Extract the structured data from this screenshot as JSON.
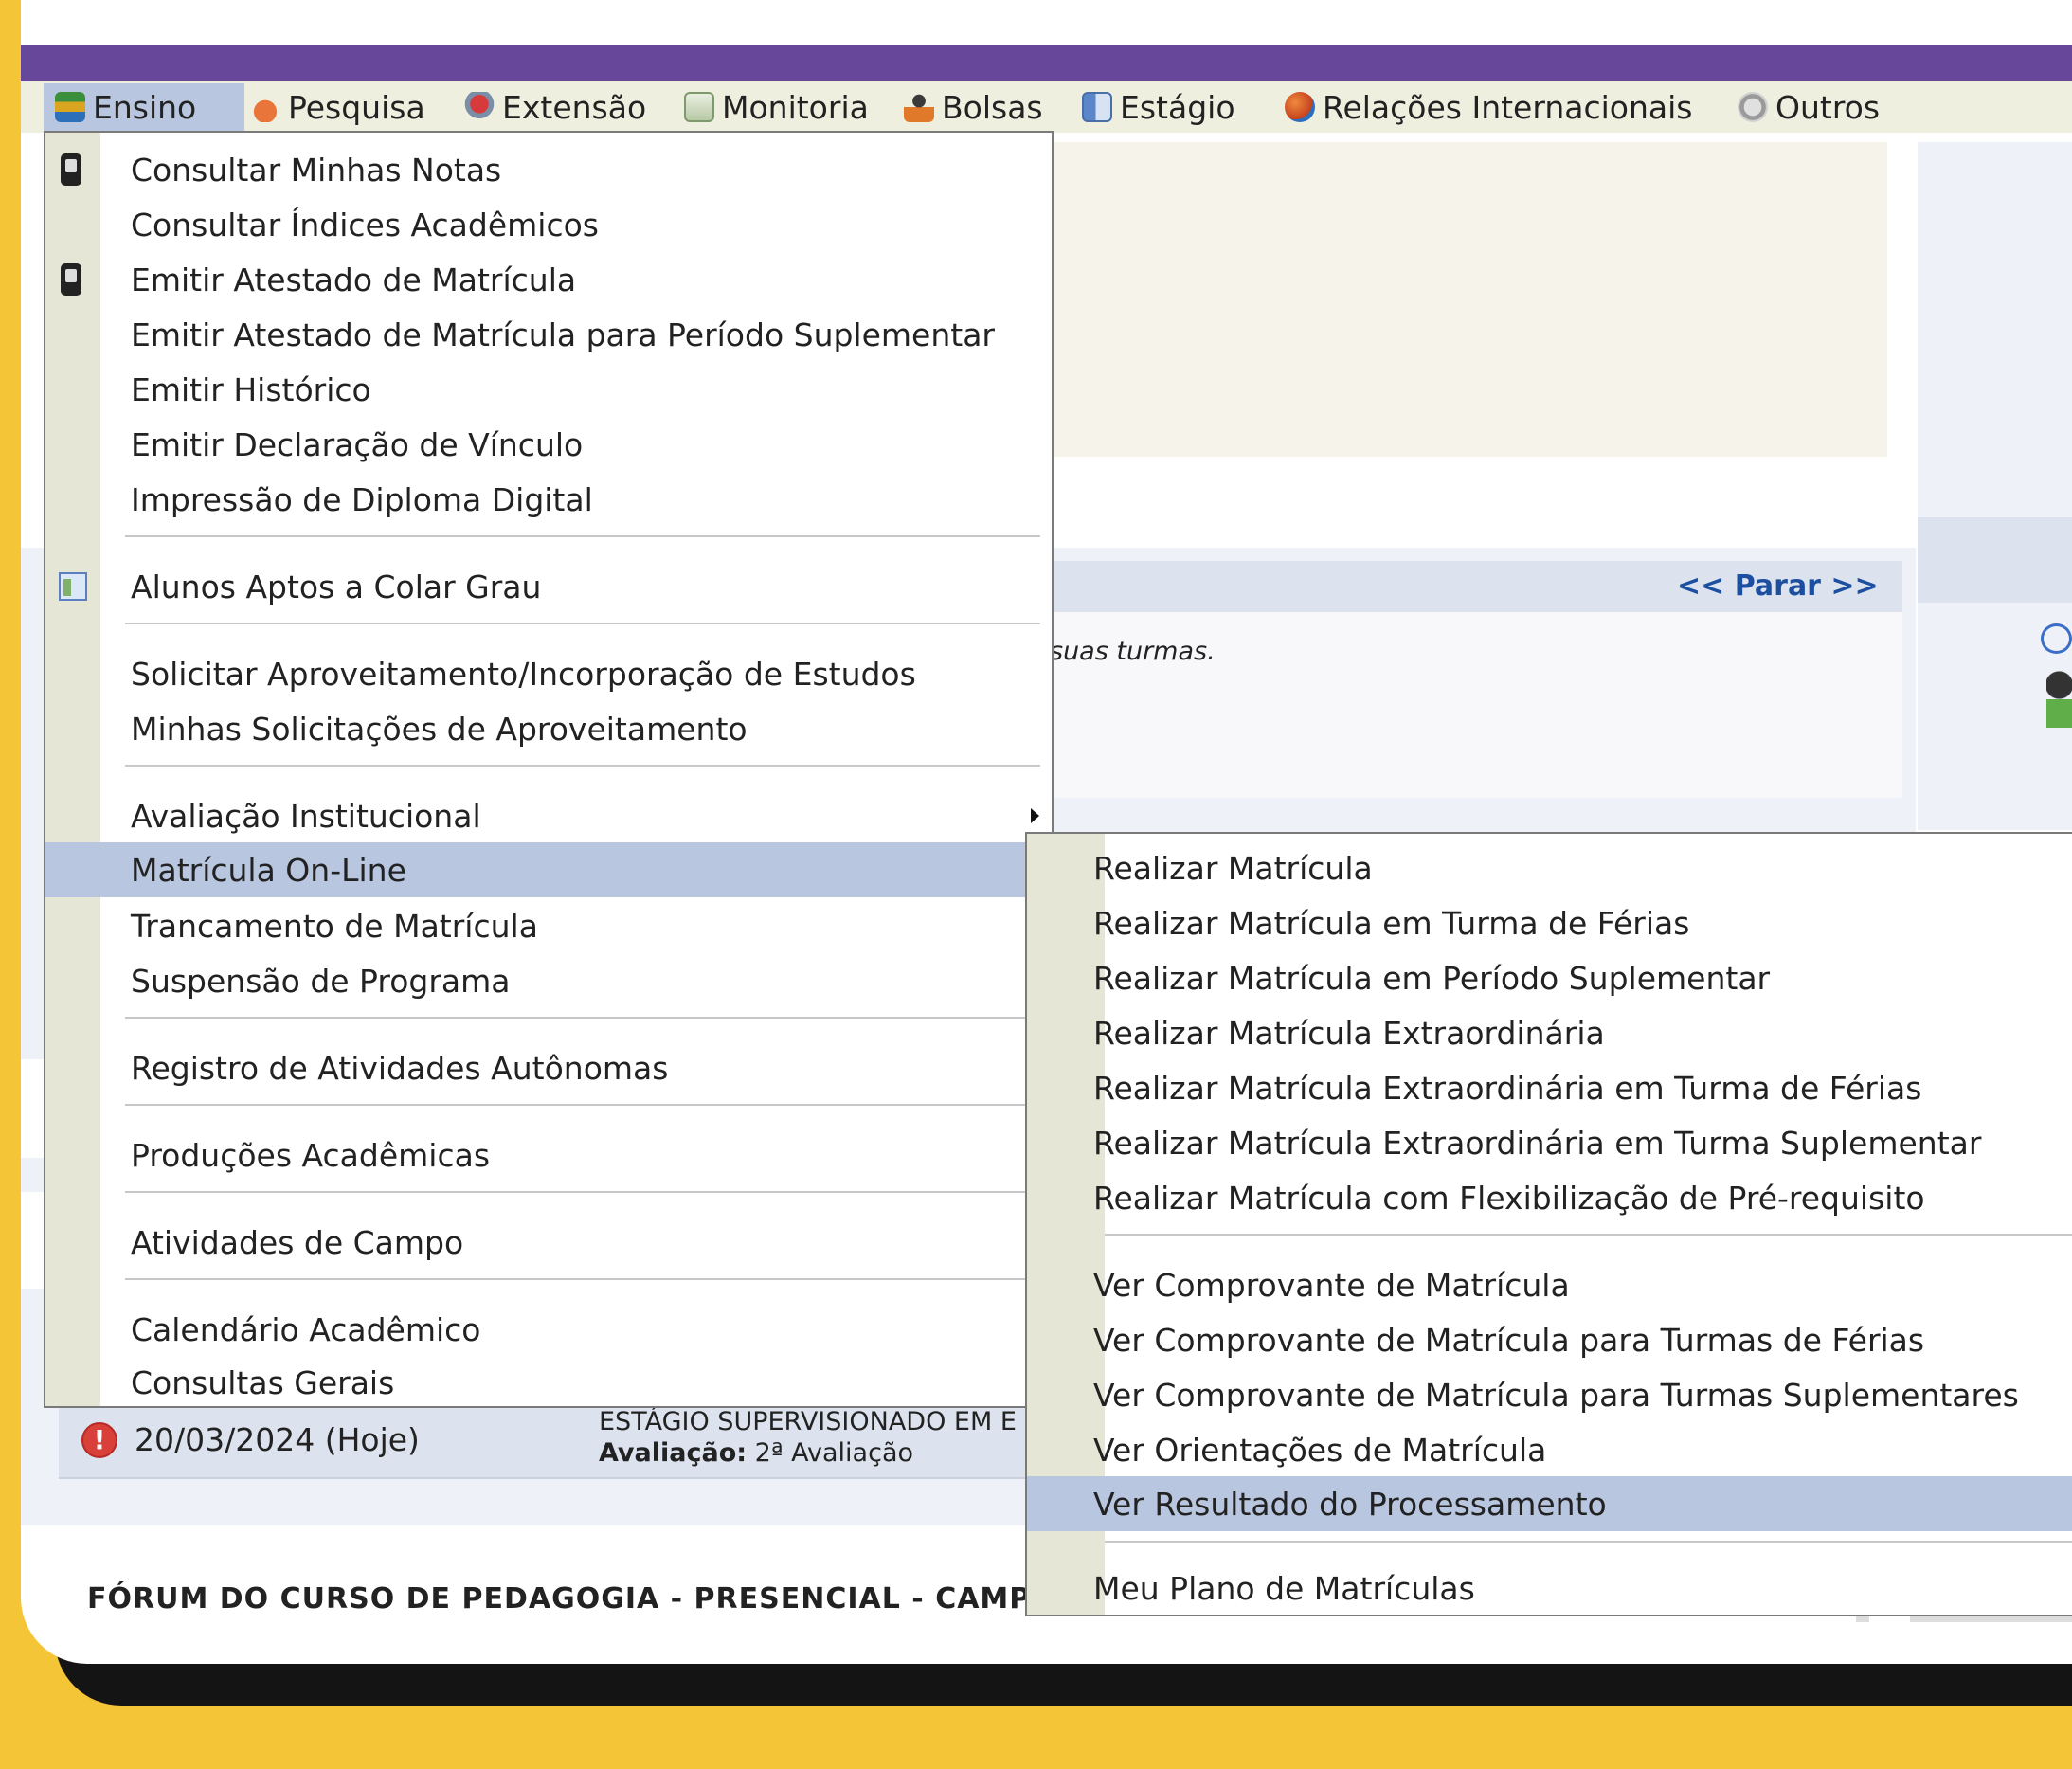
{
  "nav": {
    "items": [
      {
        "label": "Ensino",
        "icon": "books-icon"
      },
      {
        "label": "Pesquisa",
        "icon": "flask-icon"
      },
      {
        "label": "Extensão",
        "icon": "heart-hands-icon"
      },
      {
        "label": "Monitoria",
        "icon": "presentation-icon"
      },
      {
        "label": "Bolsas",
        "icon": "person-icon"
      },
      {
        "label": "Estágio",
        "icon": "id-card-icon"
      },
      {
        "label": "Relações Internacionais",
        "icon": "globe-icon"
      },
      {
        "label": "Outros",
        "icon": "robot-icon"
      }
    ]
  },
  "ensino_menu": {
    "items": [
      "Consultar Minhas Notas",
      "Consultar Índices Acadêmicos",
      "Emitir Atestado de Matrícula",
      "Emitir Atestado de Matrícula para Período Suplementar",
      "Emitir Histórico",
      "Emitir Declaração de Vínculo",
      "Impressão de Diploma Digital",
      "Alunos Aptos a Colar Grau",
      "Solicitar Aproveitamento/Incorporação de Estudos",
      "Minhas Solicitações de Aproveitamento",
      "Avaliação Institucional",
      "Matrícula On-Line",
      "Trancamento de Matrícula",
      "Suspensão de Programa",
      "Registro de Atividades Autônomas",
      "Produções Acadêmicas",
      "Atividades de Campo",
      "Calendário Acadêmico",
      "Consultas Gerais"
    ]
  },
  "matricula_submenu": {
    "items": [
      "Realizar Matrícula",
      "Realizar Matrícula em Turma de Férias",
      "Realizar Matrícula em Período Suplementar",
      "Realizar Matrícula Extraordinária",
      "Realizar Matrícula Extraordinária em Turma de Férias",
      "Realizar Matrícula Extraordinária em Turma Suplementar",
      "Realizar Matrícula com Flexibilização de Pré-requisito",
      "Ver Comprovante de Matrícula",
      "Ver Comprovante de Matrícula para Turmas de Férias",
      "Ver Comprovante de Matrícula para Turmas Suplementares",
      "Ver Orientações de Matrícula",
      "Ver Resultado do Processamento",
      "Meu Plano de Matrículas"
    ]
  },
  "background": {
    "parar_link": "<< Parar >>",
    "turmas_text": "suas turmas.",
    "date": "20/03/2024 (Hoje)",
    "estagio_title": "ESTÁGIO SUPERVISIONADO EM E",
    "avaliacao_label": "Avaliação:",
    "avaliacao_value": "2ª Avaliação",
    "forum_text": "FÓRUM DO CURSO DE PEDAGOGIA - PRESENCIAL - CAMPU"
  },
  "colors": {
    "purple_bar": "#66479a",
    "highlight": "#b8c6e0",
    "background_yellow": "#f4c537"
  }
}
